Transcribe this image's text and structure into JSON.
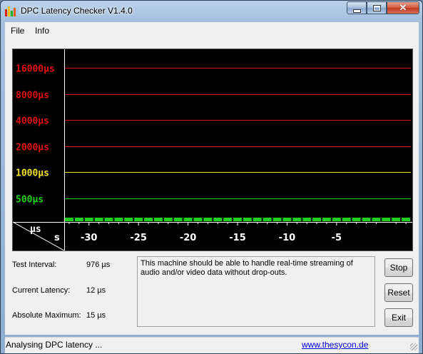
{
  "window": {
    "title": "DPC Latency Checker V1.4.0",
    "icons": {
      "app": "bar-graph-icon",
      "minimize": "minimize-icon",
      "maximize": "maximize-icon",
      "close": "close-icon"
    }
  },
  "menu": {
    "items": [
      "File",
      "Info"
    ]
  },
  "chart_data": {
    "type": "bar",
    "ylabels": [
      {
        "text": "16000µs",
        "color": "#e01010"
      },
      {
        "text": "8000µs",
        "color": "#e01010"
      },
      {
        "text": "4000µs",
        "color": "#e01010"
      },
      {
        "text": "2000µs",
        "color": "#e01010"
      },
      {
        "text": "1000µs",
        "color": "#f0e020"
      },
      {
        "text": "500µs",
        "color": "#20d020"
      }
    ],
    "ylevels_us": [
      16000,
      8000,
      4000,
      2000,
      1000,
      500
    ],
    "xticks": [
      "-30",
      "-25",
      "-20",
      "-15",
      "-10",
      "-5"
    ],
    "xtick_values": [
      -30,
      -25,
      -20,
      -15,
      -10,
      -5
    ],
    "xlim": [
      -32.5,
      2.5
    ],
    "unit_top": "µs",
    "unit_bottom": "s",
    "bar_count": 35,
    "bar_color": "#20d020",
    "background": "#000000"
  },
  "info": {
    "test_interval_label": "Test Interval:",
    "test_interval_value": "976 µs",
    "current_latency_label": "Current Latency:",
    "current_latency_value": "12 µs",
    "absolute_max_label": "Absolute Maximum:",
    "absolute_max_value": "15 µs"
  },
  "message": "This machine should be able to handle real-time streaming of audio and/or video data without drop-outs.",
  "buttons": {
    "stop": "Stop",
    "reset": "Reset",
    "exit": "Exit"
  },
  "status": {
    "text": "Analysing DPC latency ...",
    "link": "www.thesycon.de"
  }
}
